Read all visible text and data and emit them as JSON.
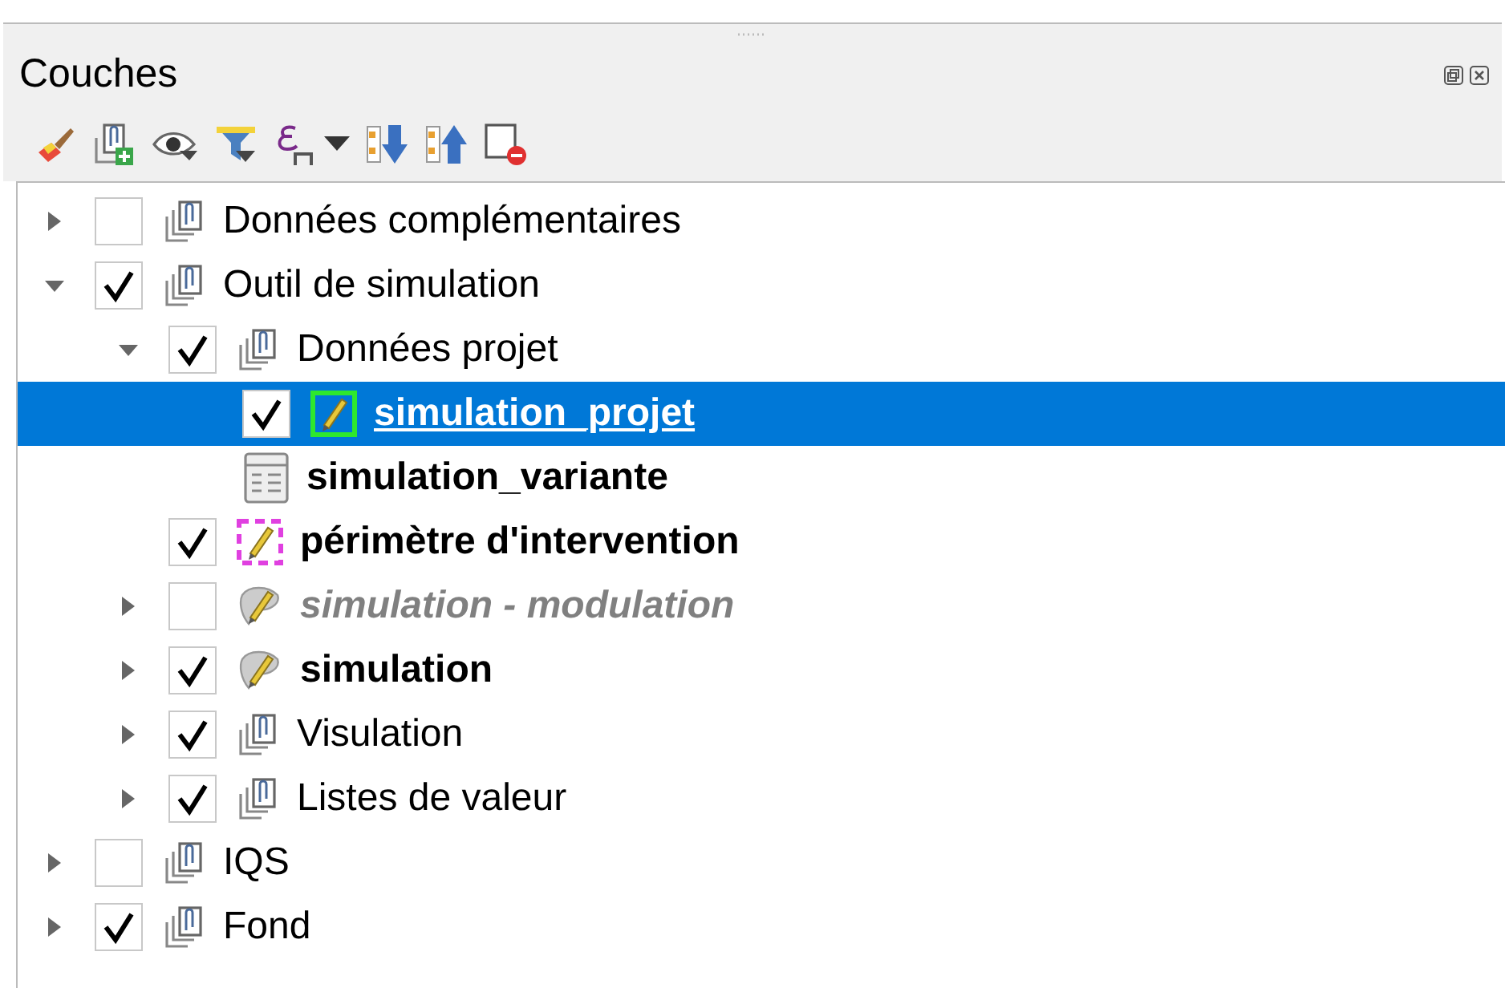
{
  "panel": {
    "title": "Couches"
  },
  "tree": [
    {
      "label": "Données complémentaires",
      "kind": "group",
      "checked": false,
      "expanded": false,
      "selected": false,
      "bold": false,
      "italic": false
    },
    {
      "label": "Outil de simulation",
      "kind": "group",
      "checked": true,
      "expanded": true,
      "selected": false,
      "bold": false,
      "italic": false,
      "children": [
        {
          "label": "Données projet",
          "kind": "group",
          "checked": true,
          "expanded": true,
          "selected": false,
          "bold": false,
          "italic": false,
          "children": [
            {
              "label": "simulation_projet",
              "kind": "pencil-green",
              "checked": true,
              "selected": true,
              "bold": true,
              "italic": false
            },
            {
              "label": "simulation_variante",
              "kind": "table",
              "selected": false,
              "bold": true,
              "italic": false
            }
          ]
        },
        {
          "label": "périmètre d'intervention",
          "kind": "pencil-dashed",
          "checked": true,
          "selected": false,
          "bold": true,
          "italic": false
        },
        {
          "label": "simulation - modulation",
          "kind": "pencil-shape",
          "checked": false,
          "expanded": false,
          "selected": false,
          "bold": true,
          "italic": true
        },
        {
          "label": "simulation",
          "kind": "pencil-shape",
          "checked": true,
          "expanded": false,
          "selected": false,
          "bold": true,
          "italic": false
        },
        {
          "label": "Visulation",
          "kind": "group",
          "checked": true,
          "expanded": false,
          "selected": false,
          "bold": false,
          "italic": false
        },
        {
          "label": "Listes de valeur",
          "kind": "group",
          "checked": true,
          "expanded": false,
          "selected": false,
          "bold": false,
          "italic": false
        }
      ]
    },
    {
      "label": "IQS",
      "kind": "group",
      "checked": false,
      "expanded": false,
      "selected": false,
      "bold": false,
      "italic": false
    },
    {
      "label": "Fond",
      "kind": "group",
      "checked": true,
      "expanded": false,
      "selected": false,
      "bold": false,
      "italic": false
    }
  ]
}
